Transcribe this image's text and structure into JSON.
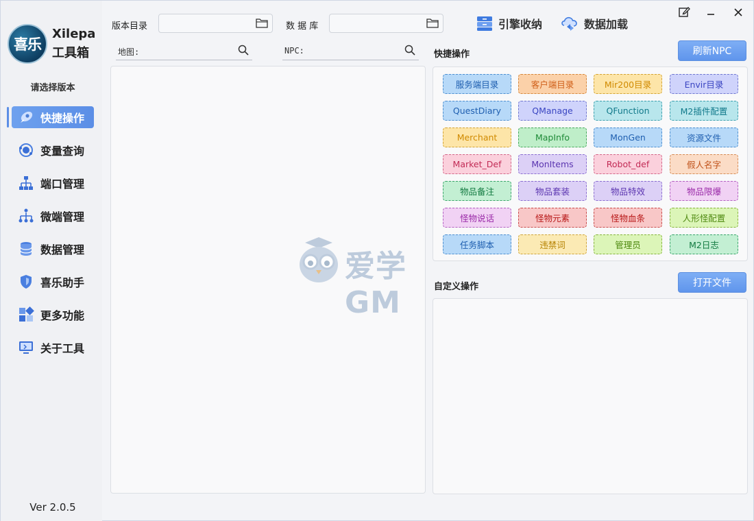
{
  "app": {
    "logo_text": "喜乐",
    "name": "Xilepa",
    "subtitle": "工具箱",
    "select_version": "请选择版本",
    "version": "Ver 2.0.5"
  },
  "sidebar": {
    "items": [
      {
        "label": "快捷操作",
        "icon": "rocket-icon",
        "active": true
      },
      {
        "label": "变量查询",
        "icon": "orbit-icon",
        "active": false
      },
      {
        "label": "端口管理",
        "icon": "network-tree-icon",
        "active": false
      },
      {
        "label": "微端管理",
        "icon": "hierarchy-icon",
        "active": false
      },
      {
        "label": "数据管理",
        "icon": "database-icon",
        "active": false
      },
      {
        "label": "喜乐助手",
        "icon": "shield-icon",
        "active": false
      },
      {
        "label": "更多功能",
        "icon": "apps-grid-icon",
        "active": false
      },
      {
        "label": "关于工具",
        "icon": "monitor-icon",
        "active": false
      }
    ]
  },
  "header": {
    "version_dir_label": "版本目录",
    "version_dir_value": "",
    "database_label": "数 据 库",
    "database_value": "",
    "engine_button": "引擎收纳",
    "data_load_button": "数据加载"
  },
  "search": {
    "map_label": "地图:",
    "npc_label": "NPC:"
  },
  "quick": {
    "title": "快捷操作",
    "refresh_button": "刷新NPC",
    "buttons": [
      {
        "label": "服务端目录",
        "color": "blue"
      },
      {
        "label": "客户端目录",
        "color": "orange"
      },
      {
        "label": "Mir200目录",
        "color": "yellow"
      },
      {
        "label": "Envir目录",
        "color": "indigo"
      },
      {
        "label": "QuestDiary",
        "color": "blue"
      },
      {
        "label": "QManage",
        "color": "indigo"
      },
      {
        "label": "QFunction",
        "color": "teal"
      },
      {
        "label": "M2插件配置",
        "color": "teal"
      },
      {
        "label": "Merchant",
        "color": "yellow"
      },
      {
        "label": "MapInfo",
        "color": "green"
      },
      {
        "label": "MonGen",
        "color": "blue"
      },
      {
        "label": "资源文件",
        "color": "blue"
      },
      {
        "label": "Market_Def",
        "color": "pink"
      },
      {
        "label": "MonItems",
        "color": "purple"
      },
      {
        "label": "Robot_def",
        "color": "pink"
      },
      {
        "label": "假人名字",
        "color": "peach"
      },
      {
        "label": "物品备注",
        "color": "tgreen"
      },
      {
        "label": "物品套装",
        "color": "purple"
      },
      {
        "label": "物品特效",
        "color": "purple"
      },
      {
        "label": "物品限爆",
        "color": "magenta"
      },
      {
        "label": "怪物说话",
        "color": "magenta"
      },
      {
        "label": "怪物元素",
        "color": "red"
      },
      {
        "label": "怪物血条",
        "color": "red"
      },
      {
        "label": "人形怪配置",
        "color": "lgreen"
      },
      {
        "label": "任务脚本",
        "color": "blue"
      },
      {
        "label": "违禁词",
        "color": "lyellow"
      },
      {
        "label": "管理员",
        "color": "lgreen"
      },
      {
        "label": "M2日志",
        "color": "tgreen"
      }
    ]
  },
  "custom": {
    "title": "自定义操作",
    "open_file_button": "打开文件"
  },
  "watermark": "爱学GM",
  "window_controls": [
    "edit-icon",
    "minimize-icon",
    "close-icon"
  ]
}
